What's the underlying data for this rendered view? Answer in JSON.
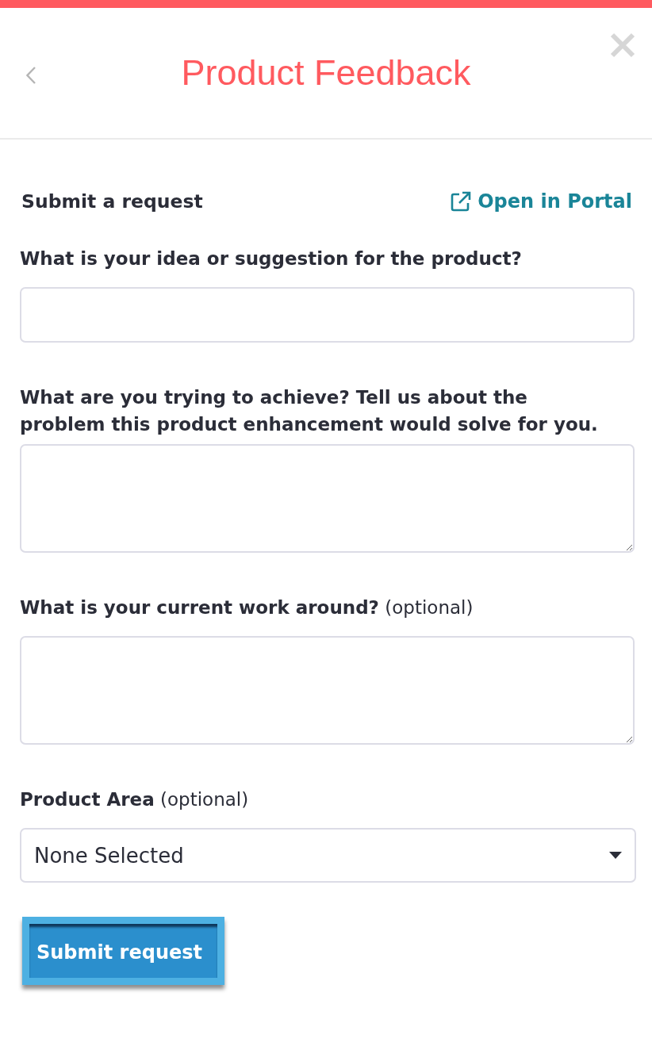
{
  "header": {
    "title": "Product Feedback"
  },
  "form": {
    "heading": "Submit a request",
    "portal_link": "Open in Portal",
    "fields": [
      {
        "kind": "input",
        "label": "What is your idea or suggestion for the product?"
      },
      {
        "kind": "textarea",
        "label": "What are you trying to achieve? Tell us about the problem this product enhancement would solve for you."
      },
      {
        "kind": "textarea",
        "label": "What is your current work around?",
        "note": "(optional)"
      },
      {
        "kind": "select",
        "label": "Product Area",
        "note": "(optional)",
        "value": "None Selected"
      }
    ],
    "submit_button": "Submit request"
  }
}
